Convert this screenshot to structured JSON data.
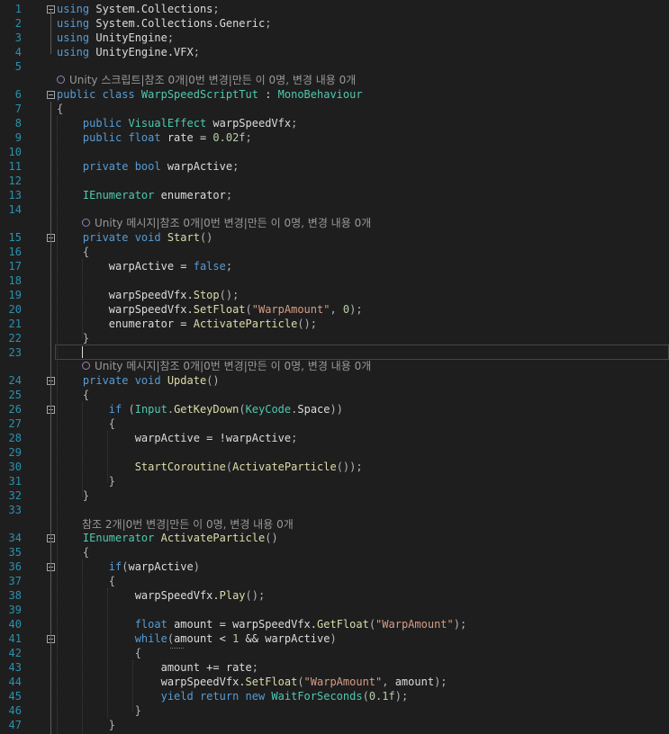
{
  "editor": {
    "colors": {
      "background": "#1e1e1e",
      "line_number": "#2b91af",
      "keyword": "#569cd6",
      "type": "#4ec9b0",
      "string": "#d69d85",
      "method": "#dcdcaa",
      "codelens": "#999999"
    },
    "lens": {
      "unity_script": "Unity 스크립트|참조 0개|0번 변경|만든 이 0명, 변경 내용 0개",
      "unity_message_start": "Unity 메시지|참조 0개|0번 변경|만든 이 0명, 변경 내용 0개",
      "unity_message_update": "Unity 메시지|참조 0개|0번 변경|만든 이 0명, 변경 내용 0개",
      "refs_activate": "참조 2개|0번 변경|만든 이 0명, 변경 내용 0개"
    },
    "lines": [
      {
        "n": "1",
        "segs": [
          [
            "kw",
            "using"
          ],
          [
            "id",
            " System.Collections"
          ],
          [
            "pun",
            ";"
          ]
        ]
      },
      {
        "n": "2",
        "segs": [
          [
            "kw",
            "using"
          ],
          [
            "id",
            " System.Collections.Generic"
          ],
          [
            "pun",
            ";"
          ]
        ]
      },
      {
        "n": "3",
        "segs": [
          [
            "kw",
            "using"
          ],
          [
            "id",
            " UnityEngine"
          ],
          [
            "pun",
            ";"
          ]
        ]
      },
      {
        "n": "4",
        "segs": [
          [
            "kw",
            "using"
          ],
          [
            "id",
            " UnityEngine.VFX"
          ],
          [
            "pun",
            ";"
          ]
        ]
      },
      {
        "n": "5",
        "segs": []
      },
      {
        "n": "6",
        "segs": [
          [
            "kw",
            "public class "
          ],
          [
            "ty",
            "WarpSpeedScriptTut"
          ],
          [
            "id",
            " : "
          ],
          [
            "ty",
            "MonoBehaviour"
          ]
        ]
      },
      {
        "n": "7",
        "segs": [
          [
            "pun",
            "{"
          ]
        ]
      },
      {
        "n": "8",
        "segs": [
          [
            "id",
            "    "
          ],
          [
            "kw",
            "public "
          ],
          [
            "ty",
            "VisualEffect"
          ],
          [
            "id",
            " warpSpeedVfx"
          ],
          [
            "pun",
            ";"
          ]
        ]
      },
      {
        "n": "9",
        "segs": [
          [
            "id",
            "    "
          ],
          [
            "kw",
            "public float "
          ],
          [
            "id",
            "rate = "
          ],
          [
            "num",
            "0.02f"
          ],
          [
            "pun",
            ";"
          ]
        ]
      },
      {
        "n": "10",
        "segs": []
      },
      {
        "n": "11",
        "segs": [
          [
            "id",
            "    "
          ],
          [
            "kw",
            "private bool "
          ],
          [
            "id",
            "warpActive"
          ],
          [
            "pun",
            ";"
          ]
        ]
      },
      {
        "n": "12",
        "segs": []
      },
      {
        "n": "13",
        "segs": [
          [
            "id",
            "    "
          ],
          [
            "ty",
            "IEnumerator"
          ],
          [
            "id",
            " enumerator"
          ],
          [
            "pun",
            ";"
          ]
        ]
      },
      {
        "n": "14",
        "segs": []
      },
      {
        "n": "15",
        "segs": [
          [
            "id",
            "    "
          ],
          [
            "kw",
            "private void "
          ],
          [
            "mth",
            "Start"
          ],
          [
            "pun",
            "()"
          ]
        ]
      },
      {
        "n": "16",
        "segs": [
          [
            "id",
            "    "
          ],
          [
            "pun",
            "{"
          ]
        ]
      },
      {
        "n": "17",
        "segs": [
          [
            "id",
            "        warpActive = "
          ],
          [
            "kw",
            "false"
          ],
          [
            "pun",
            ";"
          ]
        ]
      },
      {
        "n": "18",
        "segs": []
      },
      {
        "n": "19",
        "segs": [
          [
            "id",
            "        warpSpeedVfx."
          ],
          [
            "mth",
            "Stop"
          ],
          [
            "pun",
            "();"
          ]
        ]
      },
      {
        "n": "20",
        "segs": [
          [
            "id",
            "        warpSpeedVfx."
          ],
          [
            "mth",
            "SetFloat"
          ],
          [
            "pun",
            "("
          ],
          [
            "str",
            "\"WarpAmount\""
          ],
          [
            "pun",
            ", "
          ],
          [
            "num",
            "0"
          ],
          [
            "pun",
            ");"
          ]
        ]
      },
      {
        "n": "21",
        "segs": [
          [
            "id",
            "        enumerator = "
          ],
          [
            "mth",
            "ActivateParticle"
          ],
          [
            "pun",
            "();"
          ]
        ]
      },
      {
        "n": "22",
        "segs": [
          [
            "id",
            "    "
          ],
          [
            "pun",
            "}"
          ]
        ]
      },
      {
        "n": "23",
        "segs": []
      },
      {
        "n": "24",
        "segs": [
          [
            "id",
            "    "
          ],
          [
            "kw",
            "private void "
          ],
          [
            "mth",
            "Update"
          ],
          [
            "pun",
            "()"
          ]
        ]
      },
      {
        "n": "25",
        "segs": [
          [
            "id",
            "    "
          ],
          [
            "pun",
            "{"
          ]
        ]
      },
      {
        "n": "26",
        "segs": [
          [
            "id",
            "        "
          ],
          [
            "kw",
            "if "
          ],
          [
            "pun",
            "("
          ],
          [
            "ty",
            "Input"
          ],
          [
            "pun",
            "."
          ],
          [
            "mth",
            "GetKeyDown"
          ],
          [
            "pun",
            "("
          ],
          [
            "ty",
            "KeyCode"
          ],
          [
            "pun",
            "."
          ],
          [
            "id",
            "Space"
          ],
          [
            "pun",
            "))"
          ]
        ]
      },
      {
        "n": "27",
        "segs": [
          [
            "id",
            "        "
          ],
          [
            "pun",
            "{"
          ]
        ]
      },
      {
        "n": "28",
        "segs": [
          [
            "id",
            "            warpActive = !warpActive"
          ],
          [
            "pun",
            ";"
          ]
        ]
      },
      {
        "n": "29",
        "segs": []
      },
      {
        "n": "30",
        "segs": [
          [
            "id",
            "            "
          ],
          [
            "mth",
            "StartCoroutine"
          ],
          [
            "pun",
            "("
          ],
          [
            "mth",
            "ActivateParticle"
          ],
          [
            "pun",
            "());"
          ]
        ]
      },
      {
        "n": "31",
        "segs": [
          [
            "id",
            "        "
          ],
          [
            "pun",
            "}"
          ]
        ]
      },
      {
        "n": "32",
        "segs": [
          [
            "id",
            "    "
          ],
          [
            "pun",
            "}"
          ]
        ]
      },
      {
        "n": "33",
        "segs": []
      },
      {
        "n": "34",
        "segs": [
          [
            "id",
            "    "
          ],
          [
            "ty",
            "IEnumerator"
          ],
          [
            "id",
            " "
          ],
          [
            "mth",
            "ActivateParticle"
          ],
          [
            "pun",
            "()"
          ]
        ]
      },
      {
        "n": "35",
        "segs": [
          [
            "id",
            "    "
          ],
          [
            "pun",
            "{"
          ]
        ]
      },
      {
        "n": "36",
        "segs": [
          [
            "id",
            "        "
          ],
          [
            "kw",
            "if"
          ],
          [
            "pun",
            "("
          ],
          [
            "id",
            "warpActive"
          ],
          [
            "pun",
            ")"
          ]
        ]
      },
      {
        "n": "37",
        "segs": [
          [
            "id",
            "        "
          ],
          [
            "pun",
            "{"
          ]
        ]
      },
      {
        "n": "38",
        "segs": [
          [
            "id",
            "            warpSpeedVfx."
          ],
          [
            "mth",
            "Play"
          ],
          [
            "pun",
            "();"
          ]
        ]
      },
      {
        "n": "39",
        "segs": []
      },
      {
        "n": "40",
        "segs": [
          [
            "id",
            "            "
          ],
          [
            "kw",
            "float "
          ],
          [
            "id",
            "amount = warpSpeedVfx."
          ],
          [
            "mth",
            "GetFloat"
          ],
          [
            "pun",
            "("
          ],
          [
            "str",
            "\"WarpAmount\""
          ],
          [
            "pun",
            ");"
          ]
        ]
      },
      {
        "n": "41",
        "segs": [
          [
            "id",
            "            "
          ],
          [
            "kw",
            "while"
          ],
          [
            "pun",
            "("
          ],
          [
            "id",
            "amount < "
          ],
          [
            "num",
            "1"
          ],
          [
            "id",
            " && warpActive"
          ],
          [
            "pun",
            ")"
          ]
        ]
      },
      {
        "n": "42",
        "segs": [
          [
            "id",
            "            "
          ],
          [
            "pun",
            "{"
          ]
        ]
      },
      {
        "n": "43",
        "segs": [
          [
            "id",
            "                amount += rate"
          ],
          [
            "pun",
            ";"
          ]
        ]
      },
      {
        "n": "44",
        "segs": [
          [
            "id",
            "                warpSpeedVfx."
          ],
          [
            "mth",
            "SetFloat"
          ],
          [
            "pun",
            "("
          ],
          [
            "str",
            "\"WarpAmount\""
          ],
          [
            "pun",
            ", "
          ],
          [
            "id",
            "amount"
          ],
          [
            "pun",
            ");"
          ]
        ]
      },
      {
        "n": "45",
        "segs": [
          [
            "id",
            "                "
          ],
          [
            "kw",
            "yield return new "
          ],
          [
            "ty",
            "WaitForSeconds"
          ],
          [
            "pun",
            "("
          ],
          [
            "num",
            "0.1f"
          ],
          [
            "pun",
            ");"
          ]
        ]
      },
      {
        "n": "46",
        "segs": [
          [
            "id",
            "            "
          ],
          [
            "pun",
            "}"
          ]
        ]
      },
      {
        "n": "47",
        "segs": [
          [
            "id",
            "        "
          ],
          [
            "pun",
            "}"
          ]
        ]
      }
    ]
  }
}
